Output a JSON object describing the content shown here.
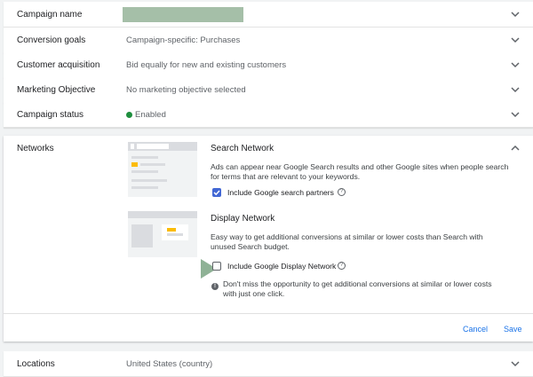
{
  "rows": [
    {
      "label": "Campaign name",
      "value": ""
    },
    {
      "label": "Conversion goals",
      "value": "Campaign-specific: Purchases"
    },
    {
      "label": "Customer acquisition",
      "value": "Bid equally for new and existing customers"
    },
    {
      "label": "Marketing Objective",
      "value": "No marketing objective selected"
    },
    {
      "label": "Campaign status",
      "value": "Enabled"
    }
  ],
  "networks": {
    "label": "Networks",
    "search": {
      "title": "Search Network",
      "desc_line1": "Ads can appear near Google Search results and other Google sites when people search",
      "desc_line2": "for terms that are relevant to your keywords.",
      "checkbox_label": "Include Google search partners",
      "checked": true
    },
    "display": {
      "title": "Display Network",
      "desc_line1": "Easy way to get additional conversions at similar or lower costs than Search with",
      "desc_line2": "unused Search budget.",
      "checkbox_label": "Include Google Display Network",
      "checked": false,
      "info_line1": "Don't miss the opportunity to get additional conversions at similar or lower costs",
      "info_line2": "with just one click."
    },
    "cancel": "Cancel",
    "save": "Save"
  },
  "locations": {
    "label": "Locations",
    "value": "United States (country)"
  },
  "colors": {
    "accent": "#1a73e8",
    "checkbox": "#4267d4",
    "status": "#1e8e3e",
    "mask": "#a5bfa8"
  },
  "icons": {
    "expand": "chevron-down-icon",
    "collapse": "chevron-up-icon",
    "help": "help-circle-icon",
    "info": "info-icon"
  }
}
